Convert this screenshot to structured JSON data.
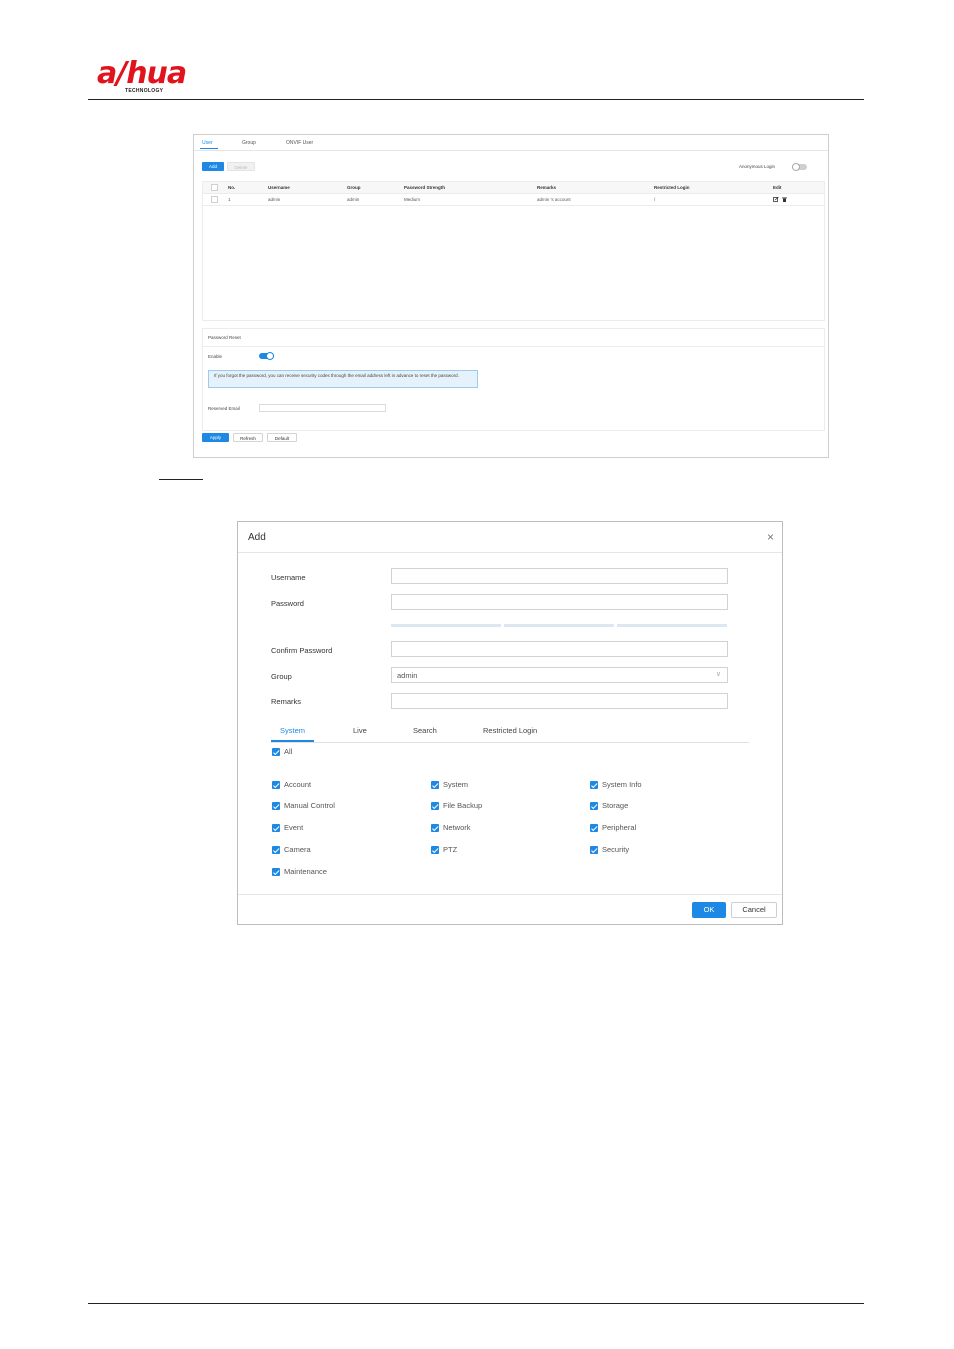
{
  "header": {
    "logo_main": "a/hua",
    "logo_sub": "TECHNOLOGY"
  },
  "user_page": {
    "tabs": [
      "User",
      "Group",
      "ONVIF User"
    ],
    "add_label": "Add",
    "delete_label": "Delete",
    "anonymous_login_label": "Anonymous Login",
    "table": {
      "headers": [
        "No.",
        "Username",
        "Group",
        "Password Strength",
        "Remarks",
        "Restricted Login",
        "Edit"
      ],
      "rows": [
        {
          "no": "1",
          "username": "admin",
          "group": "admin",
          "strength": "Medium",
          "remarks": "admin 's account",
          "restricted": "/"
        }
      ]
    },
    "password_reset": {
      "title": "Password Reset",
      "enable_label": "Enable",
      "hint": "If you forgot the password, you can receive security codes through the email address left in advance to reset the password.",
      "email_label": "Reserved Email"
    },
    "apply_label": "Apply",
    "refresh_label": "Refresh",
    "default_label": "Default"
  },
  "dialog": {
    "title": "Add",
    "close_glyph": "×",
    "fields": {
      "username": "Username",
      "password": "Password",
      "confirm": "Confirm Password",
      "group": "Group",
      "group_value": "admin",
      "remarks": "Remarks"
    },
    "tabs": [
      "System",
      "Live",
      "Search",
      "Restricted Login"
    ],
    "all_label": "All",
    "permissions": [
      "Account",
      "System",
      "System Info",
      "Manual Control",
      "File Backup",
      "Storage",
      "Event",
      "Network",
      "Peripheral",
      "Camera",
      "PTZ",
      "Security",
      "Maintenance"
    ],
    "ok_label": "OK",
    "cancel_label": "Cancel"
  },
  "colors": {
    "accent": "#1e88e5",
    "brand": "#e1141e"
  }
}
